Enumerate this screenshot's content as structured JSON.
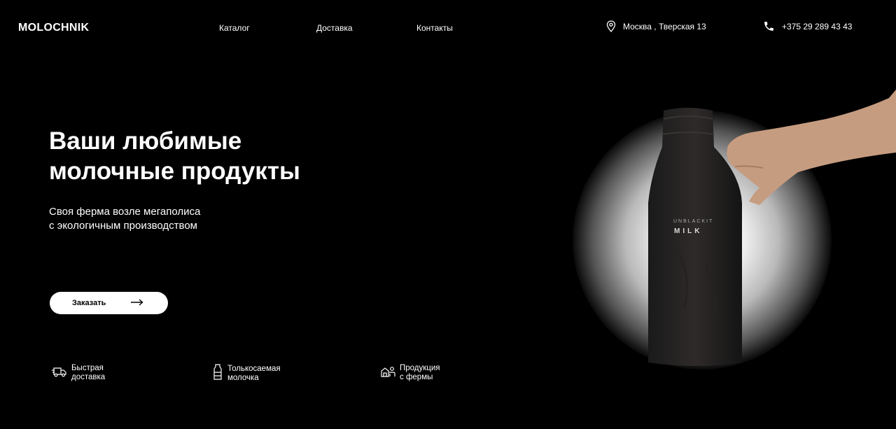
{
  "header": {
    "logo": "MOLOCHNIK",
    "nav": [
      {
        "label": "Каталог"
      },
      {
        "label": "Доставка"
      },
      {
        "label": "Контакты"
      }
    ],
    "address": {
      "icon": "location-pin-icon",
      "text": "Москва , Тверская 13"
    },
    "phone": {
      "icon": "phone-icon",
      "text": "+375 29 289 43 43"
    }
  },
  "hero": {
    "title_line1": "Ваши любимые",
    "title_line2": "молочные продукты",
    "subtitle_line1": "Своя ферма возле мегаполиса",
    "subtitle_line2": "с экологичным производством",
    "cta_label": "Заказать",
    "cta_icon": "arrow-right-icon"
  },
  "features": [
    {
      "icon": "delivery-truck-icon",
      "line1": "Быстрая",
      "line2": "доставка"
    },
    {
      "icon": "milk-bottle-icon",
      "line1": "Толькосаемая",
      "line2": "молочка"
    },
    {
      "icon": "farm-cow-icon",
      "line1": "Продукция",
      "line2": "с фермы"
    }
  ],
  "product_image": {
    "bottle_label_small": "UNBLACKIT",
    "bottle_label_large": "MILK"
  }
}
